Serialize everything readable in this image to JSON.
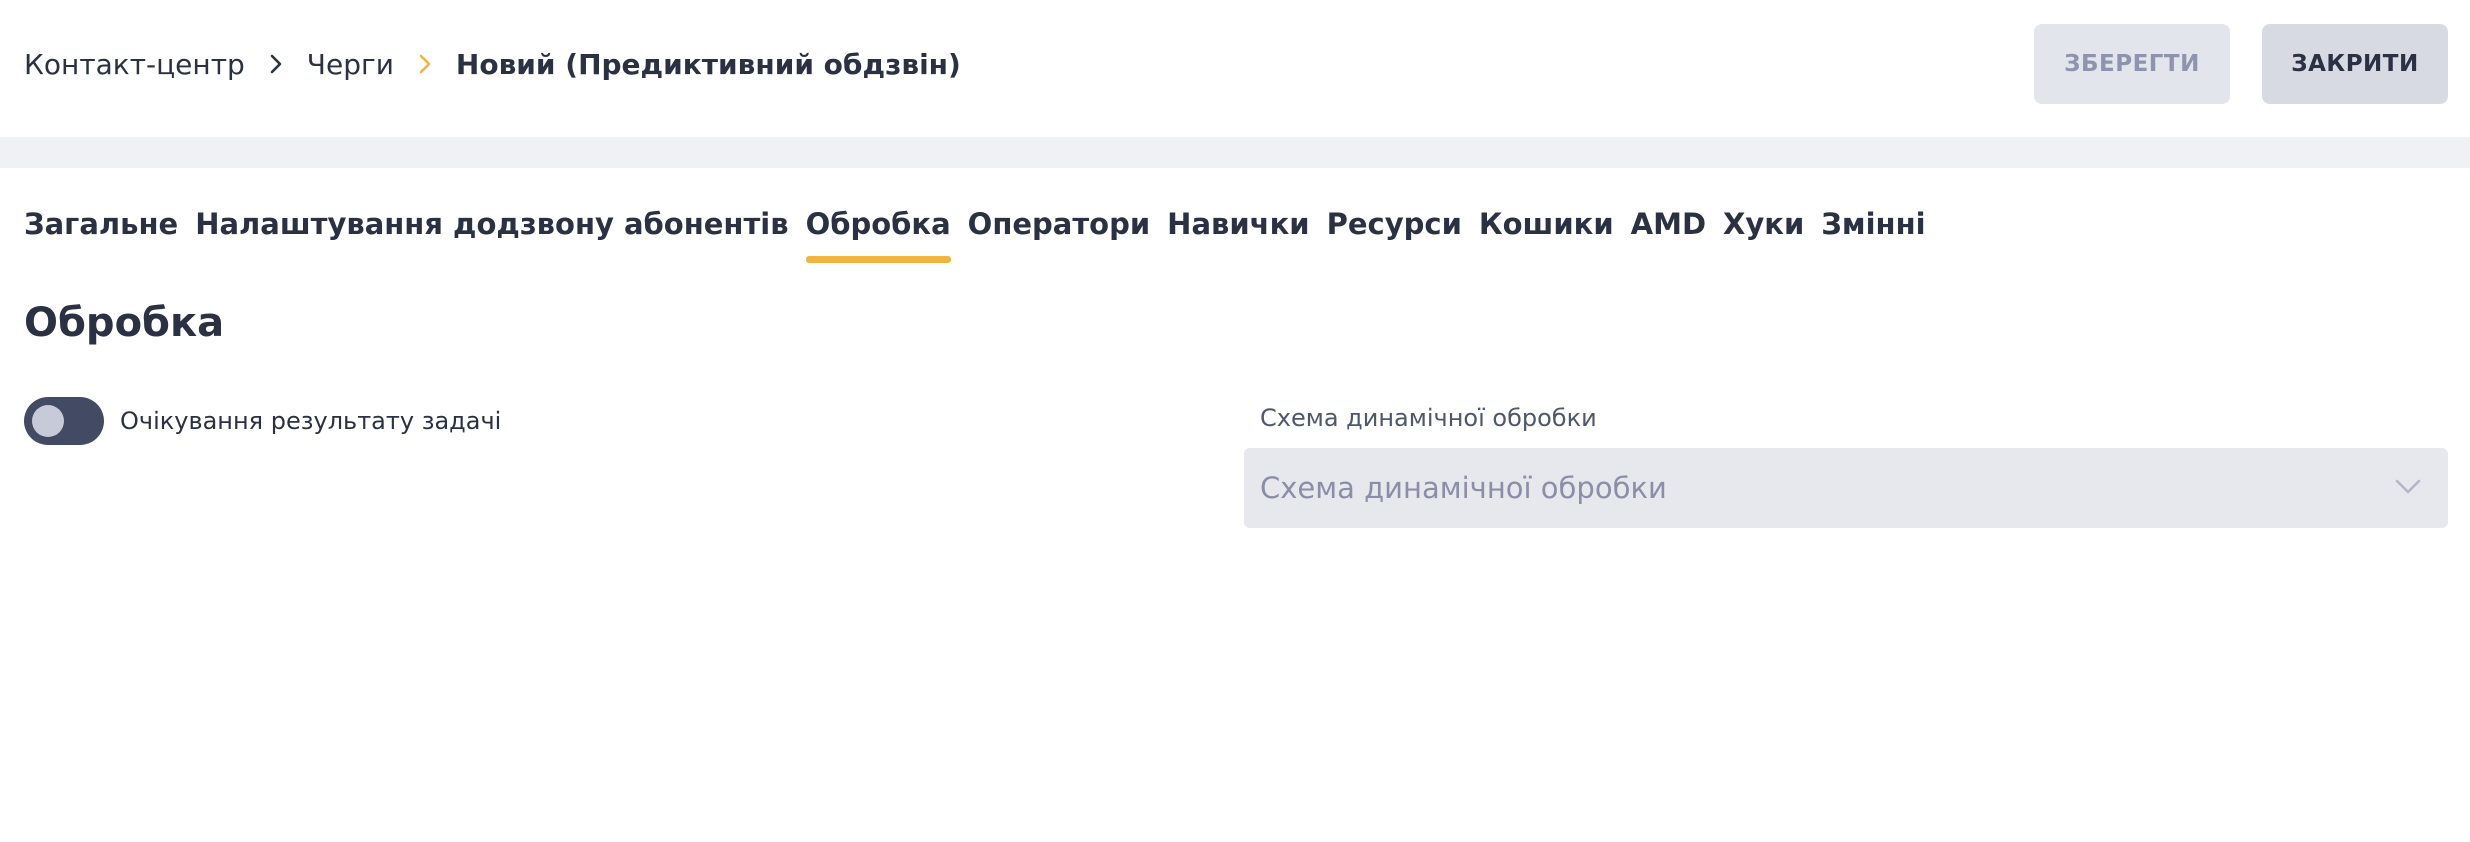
{
  "breadcrumb": {
    "items": [
      "Контакт-центр",
      "Черги",
      "Новий (Предиктивний обдзвін)"
    ],
    "separator_colors": [
      "#2b3142",
      "#f0b53e"
    ]
  },
  "header": {
    "save_label": "ЗБЕРЕГТИ",
    "close_label": "ЗАКРИТИ"
  },
  "tabs": [
    {
      "label": "Загальне",
      "active": false
    },
    {
      "label": "Налаштування додзвону абонентів",
      "active": false
    },
    {
      "label": "Обробка",
      "active": true
    },
    {
      "label": "Оператори",
      "active": false
    },
    {
      "label": "Навички",
      "active": false
    },
    {
      "label": "Ресурси",
      "active": false
    },
    {
      "label": "Кошики",
      "active": false
    },
    {
      "label": "AMD",
      "active": false
    },
    {
      "label": "Хуки",
      "active": false
    },
    {
      "label": "Змінні",
      "active": false
    }
  ],
  "section": {
    "title": "Обробка",
    "toggle": {
      "label": "Очікування результату задачі",
      "on": false
    },
    "dynamic_scheme": {
      "label": "Схема динамічної обробки",
      "placeholder": "Схема динамічної обробки",
      "icon": "chevron-down-icon"
    }
  },
  "colors": {
    "accent": "#f0b53e",
    "text": "#2b3142",
    "toggle_track": "#434a63",
    "disabled_button": "#e3e5ed"
  }
}
